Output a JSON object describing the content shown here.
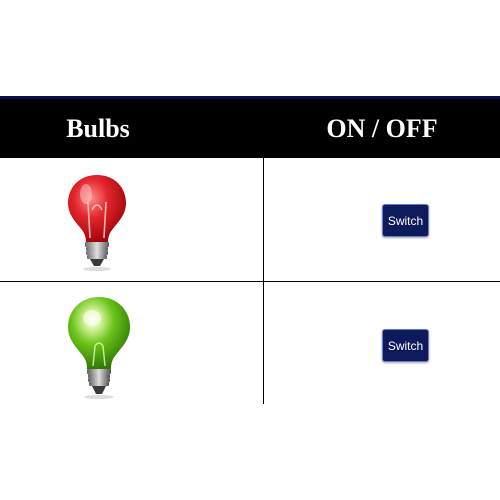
{
  "header": {
    "col_bulbs": "Bulbs",
    "col_onoff": "ON / OFF"
  },
  "rows": [
    {
      "bulb_state": "red",
      "bulb_color": "#e3262b",
      "switch_label": "Switch"
    },
    {
      "bulb_state": "green",
      "bulb_color": "#6cc31a",
      "switch_label": "Switch"
    }
  ],
  "colors": {
    "header_bg": "#000000",
    "header_text": "#ffffff",
    "button_bg": "#0d1a5c",
    "button_text": "#ffffff"
  }
}
